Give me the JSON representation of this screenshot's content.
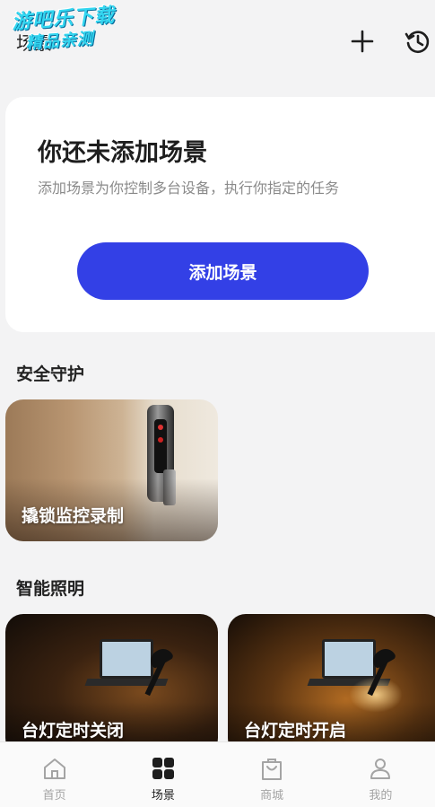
{
  "watermark": {
    "line1": "游吧乐下载",
    "line2": "精品亲测"
  },
  "header": {
    "title": "场景",
    "add_icon": "plus-icon",
    "history_icon": "history-icon"
  },
  "empty_state": {
    "title": "你还未添加场景",
    "description": "添加场景为你控制多台设备，执行你指定的任务",
    "button_label": "添加场景",
    "button_color": "#3340e6"
  },
  "sections": [
    {
      "title": "安全守护",
      "cards": [
        {
          "label": "撬锁监控录制"
        }
      ]
    },
    {
      "title": "智能照明",
      "cards": [
        {
          "label": "台灯定时关闭"
        },
        {
          "label": "台灯定时开启"
        }
      ]
    }
  ],
  "tabbar": {
    "items": [
      {
        "label": "首页",
        "icon": "home-icon",
        "active": false
      },
      {
        "label": "场景",
        "icon": "grid-icon",
        "active": true
      },
      {
        "label": "商城",
        "icon": "shopping-bag-icon",
        "active": false
      },
      {
        "label": "我的",
        "icon": "user-icon",
        "active": false
      }
    ]
  }
}
